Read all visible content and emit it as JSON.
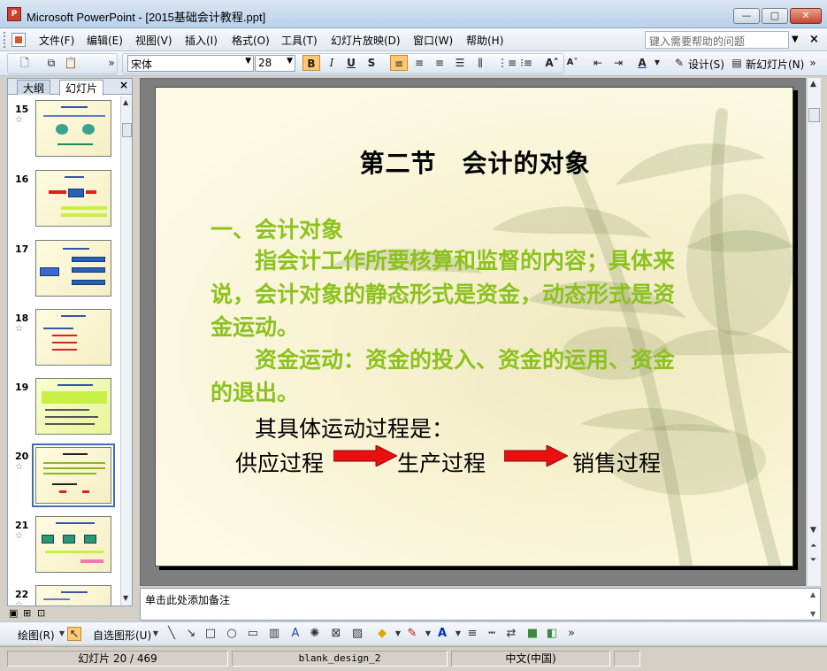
{
  "window": {
    "title": "Microsoft PowerPoint - [2015基础会计教程.ppt]",
    "app_icon_label": "P",
    "minimize_glyph": "—",
    "maximize_glyph": "□",
    "close_glyph": "✕"
  },
  "menubar": {
    "items": [
      "文件(F)",
      "编辑(E)",
      "视图(V)",
      "插入(I)",
      "格式(O)",
      "工具(T)",
      "幻灯片放映(D)",
      "窗口(W)",
      "帮助(H)"
    ],
    "help_placeholder": "键入需要帮助的问题"
  },
  "toolbar": {
    "font_name": "宋体",
    "font_size": "28",
    "bold": "B",
    "italic": "I",
    "underline": "U",
    "shadow": "S",
    "design_label": "设计(S)",
    "new_slide_label": "新幻灯片(N)"
  },
  "left_pane": {
    "tabs": [
      "大纲",
      "幻灯片"
    ],
    "active_tab": "幻灯片",
    "slides": [
      {
        "number": "15",
        "star": "☆"
      },
      {
        "number": "16",
        "star": ""
      },
      {
        "number": "17",
        "star": ""
      },
      {
        "number": "18",
        "star": "☆"
      },
      {
        "number": "19",
        "star": ""
      },
      {
        "number": "20",
        "star": "☆"
      },
      {
        "number": "21",
        "star": "☆"
      },
      {
        "number": "22",
        "star": "☆"
      }
    ],
    "selected_slide": "20"
  },
  "slide": {
    "title": "第二节　会计的对象",
    "line1": "一、会计对象",
    "line2": "　　指会计工作所要核算和监督的内容；具体来",
    "line3": "说，会计对象的静态形式是资金，动态形式是资",
    "line4": "金运动。",
    "line5": "　　资金运动：资金的投入、资金的运用、资金",
    "line6": "的退出。",
    "line7": "其具体运动过程是：",
    "process": [
      "供应过程",
      "生产过程",
      "销售过程"
    ],
    "text_color": "#8cc21e",
    "arrow_color": "#e81010"
  },
  "notes": {
    "placeholder": "单击此处添加备注"
  },
  "drawbar": {
    "draw_label": "绘图(R)",
    "autoshape_label": "自选图形(U)"
  },
  "statusbar": {
    "slide_position": "幻灯片 20 / 469",
    "design_name": "blank_design_2",
    "language": "中文(中国)"
  }
}
